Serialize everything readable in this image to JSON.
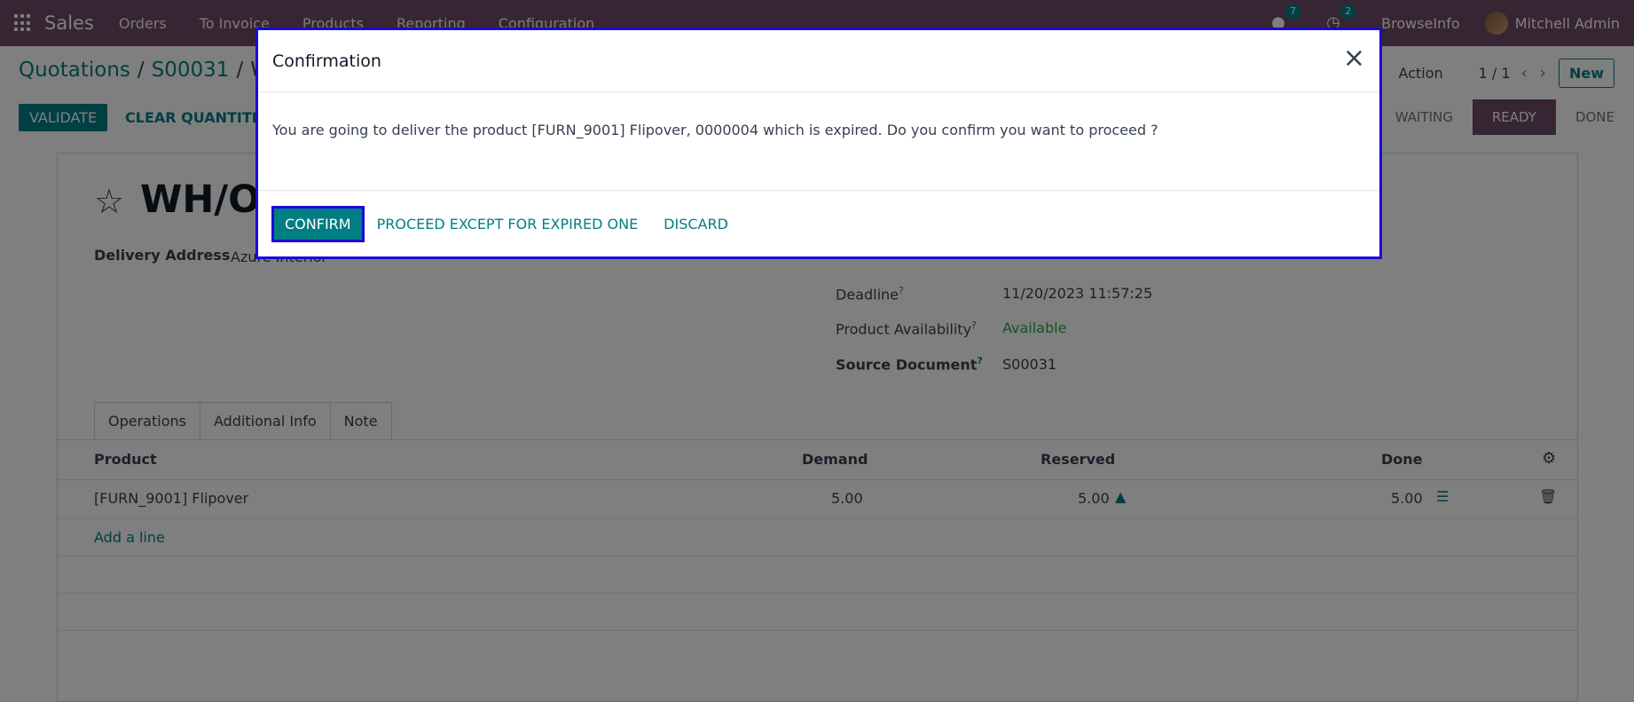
{
  "navbar": {
    "app_name": "Sales",
    "menu": [
      "Orders",
      "To Invoice",
      "Products",
      "Reporting",
      "Configuration"
    ],
    "messages_badge": "7",
    "activities_badge": "2",
    "company": "BrowseInfo",
    "user": "Mitchell Admin"
  },
  "control_panel": {
    "breadcrumb": [
      "Quotations",
      "S00031",
      "W"
    ],
    "action_label": "Action",
    "pager": "1 / 1",
    "new_label": "New",
    "validate_label": "VALIDATE",
    "clear_label": "CLEAR QUANTITIES",
    "statuses": [
      "WAITING",
      "READY",
      "DONE"
    ],
    "active_status": "READY"
  },
  "form": {
    "record_name": "WH/OUT",
    "delivery_address_label": "Delivery Address",
    "delivery_address_value": "Azure Interior",
    "fields": [
      {
        "label": "Deadline",
        "value": "11/20/2023 11:57:25"
      },
      {
        "label": "Product Availability",
        "value": "Available"
      },
      {
        "label": "Source Document",
        "value": "S00031"
      }
    ],
    "tabs": [
      "Operations",
      "Additional Info",
      "Note"
    ],
    "table": {
      "headers": [
        "Product",
        "Demand",
        "Reserved",
        "Done"
      ],
      "rows": [
        {
          "product": "[FURN_9001] Flipover",
          "demand": "5.00",
          "reserved": "5.00",
          "done": "5.00"
        }
      ],
      "add_line": "Add a line"
    }
  },
  "modal": {
    "title": "Confirmation",
    "message": "You are going to deliver the product [FURN_9001] Flipover, 0000004 which is expired. Do you confirm you want to proceed ?",
    "confirm_label": "CONFIRM",
    "proceed_label": "PROCEED EXCEPT FOR EXPIRED ONE",
    "discard_label": "DISCARD"
  },
  "colors": {
    "navbar": "#714b67",
    "primary": "#017e84",
    "highlight_border": "#1a0bd6",
    "available": "#28a745"
  }
}
